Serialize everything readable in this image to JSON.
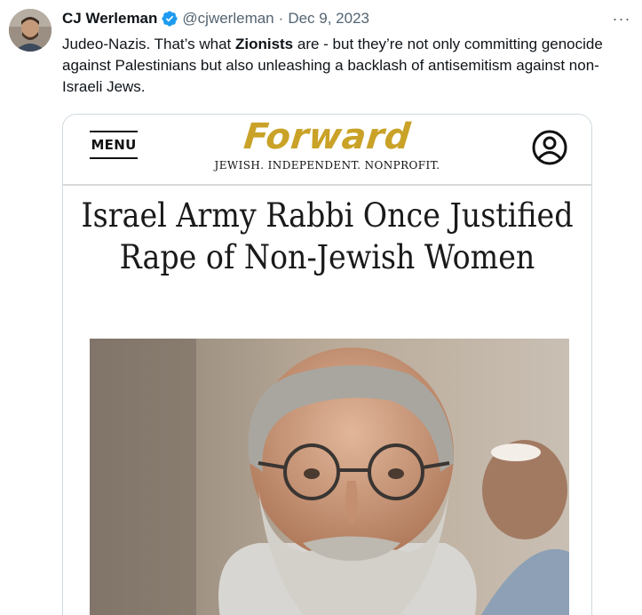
{
  "tweet": {
    "author_name": "CJ Werleman",
    "handle": "@cjwerleman",
    "separator": "·",
    "date": "Dec 9, 2023",
    "more_label": "···",
    "text_part1": "Judeo-Nazis. That’s what ",
    "text_bold": "Zionists",
    "text_part2": " are - but they’re not only committing genocide against Palestinians but also unleashing a backlash of antisemitism against non-Israeli Jews.",
    "icons": [
      "avatar",
      "verified-badge-icon",
      "more-icon"
    ],
    "colors": {
      "verified": "#1d9bf0",
      "secondary_text": "#536471",
      "border": "#cfd9de"
    }
  },
  "card": {
    "menu_label": "MENU",
    "logo_text": "Forward",
    "tagline": "JEWISH. INDEPENDENT. NONPROFIT.",
    "headline": "Israel Army Rabbi Once Justified Rape of Non-Jewish Women",
    "icons": [
      "account-icon"
    ],
    "colors": {
      "logo": "#c9a227"
    }
  }
}
